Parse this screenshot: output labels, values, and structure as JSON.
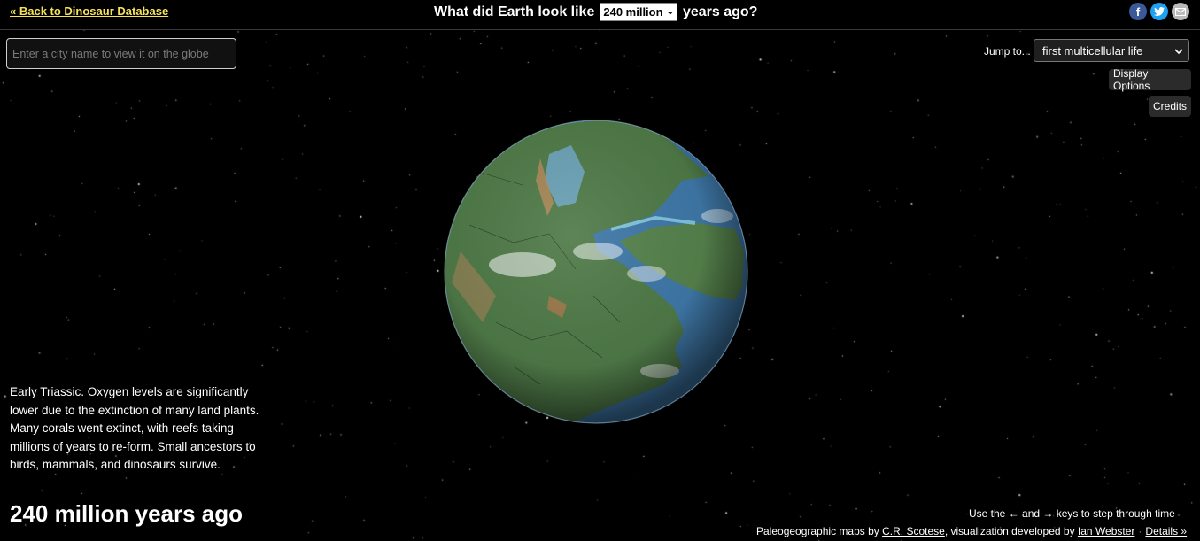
{
  "header": {
    "back_link": "« Back to Dinosaur Database",
    "headline_before": "What did Earth look like",
    "selected_years": "240 million",
    "headline_after": "years ago?",
    "share_icons": [
      "facebook-icon",
      "twitter-icon",
      "email-icon"
    ]
  },
  "search": {
    "placeholder": "Enter a city name to view it on the globe",
    "value": ""
  },
  "jump": {
    "label": "Jump to...",
    "selected": "first multicellular life"
  },
  "buttons": {
    "display_options": "Display Options",
    "credits": "Credits"
  },
  "description": "Early Triassic. Oxygen levels are significantly lower due to the extinction of many land plants. Many corals went extinct, with reefs taking millions of years to re-form. Small ancestors to birds, mammals, and dinosaurs survive.",
  "big_title": "240 million years ago",
  "footer": {
    "keys_hint": "Use the ← and → keys to step through time",
    "credits_prefix": "Paleogeographic maps by",
    "scotese": "C.R. Scotese",
    "credits_middle": ", visualization developed by",
    "webster": "Ian Webster",
    "details": "Details »"
  },
  "colors": {
    "background": "#000000",
    "link_yellow": "#f7e35a",
    "ocean": "#3f78a8",
    "land": "#4f7a48"
  }
}
